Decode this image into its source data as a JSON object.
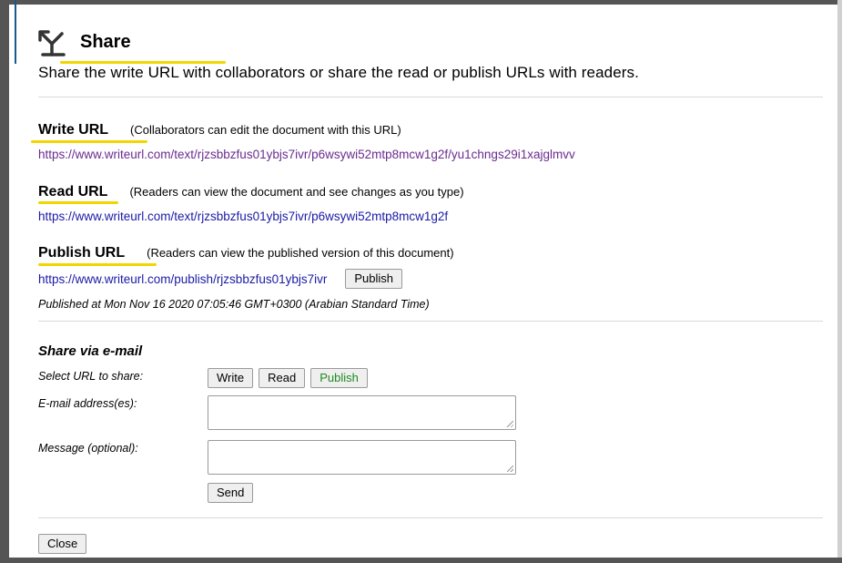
{
  "dialog": {
    "title": "Share",
    "icon": "share-arrows-icon",
    "intro": "Share the write URL with collaborators or share the read or publish URLs with readers."
  },
  "write": {
    "label": "Write URL",
    "description": "(Collaborators can edit the document with this URL)",
    "url": "https://www.writeurl.com/text/rjzsbbzfus01ybjs7ivr/p6wsywi52mtp8mcw1g2f/yu1chngs29i1xajglmvv"
  },
  "read": {
    "label": "Read URL",
    "description": "(Readers can view the document and see changes as you type)",
    "url": "https://www.writeurl.com/text/rjzsbbzfus01ybjs7ivr/p6wsywi52mtp8mcw1g2f"
  },
  "publish": {
    "label": "Publish URL",
    "description": "(Readers can view the published version of this document)",
    "url": "https://www.writeurl.com/publish/rjzsbbzfus01ybjs7ivr",
    "button": "Publish",
    "status": "Published at Mon Nov 16 2020 07:05:46 GMT+0300 (Arabian Standard Time)"
  },
  "email": {
    "title": "Share via e-mail",
    "select_label": "Select URL to share:",
    "options": [
      "Write",
      "Read",
      "Publish"
    ],
    "selected": "Publish",
    "address_label": "E-mail address(es):",
    "address_value": "",
    "message_label": "Message (optional):",
    "message_value": "",
    "send": "Send"
  },
  "footer": {
    "close": "Close"
  },
  "colors": {
    "highlight": "#f2d600",
    "link": "#1a1aa6",
    "visited": "#6b2b8f",
    "selected_option": "#1f8a1f"
  }
}
